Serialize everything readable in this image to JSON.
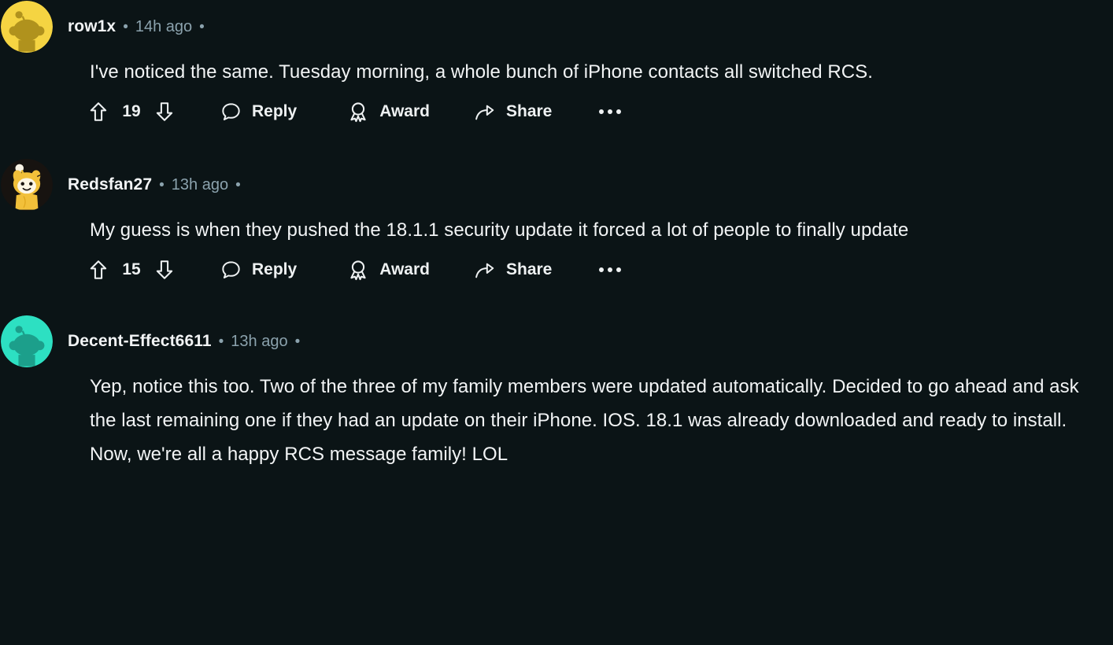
{
  "theme": {
    "background": "#0b1416",
    "text_primary": "#f2f4f5",
    "text_muted": "#8ba2ad"
  },
  "comments": [
    {
      "id": "comment-1",
      "username": "row1x",
      "timestamp": "14h ago",
      "separator": "•",
      "avatar": {
        "name": "avatar-snoo-yellow",
        "circle_color": "#f5d442",
        "snoo_color": "#b99a1f"
      },
      "body": "I've noticed the same. Tuesday morning, a whole bunch of iPhone contacts all switched RCS.",
      "actions": {
        "upvote_icon": "upvote-arrow-icon",
        "vote_count": "19",
        "downvote_icon": "downvote-arrow-icon",
        "reply_icon": "comment-bubble-icon",
        "reply_label": "Reply",
        "award_icon": "award-medal-icon",
        "award_label": "Award",
        "share_icon": "share-arrow-icon",
        "share_label": "Share",
        "more_icon": "more-options-icon"
      }
    },
    {
      "id": "comment-2",
      "username": "Redsfan27",
      "timestamp": "13h ago",
      "separator": "•",
      "avatar": {
        "name": "avatar-snoo-tiger-costume",
        "circle_color": "#1a1410",
        "snoo_color": "#f2c03a"
      },
      "body": "My guess is when they pushed the 18.1.1 security update it forced a lot of people to finally update",
      "actions": {
        "upvote_icon": "upvote-arrow-icon",
        "vote_count": "15",
        "downvote_icon": "downvote-arrow-icon",
        "reply_icon": "comment-bubble-icon",
        "reply_label": "Reply",
        "award_icon": "award-medal-icon",
        "award_label": "Award",
        "share_icon": "share-arrow-icon",
        "share_label": "Share",
        "more_icon": "more-options-icon"
      }
    },
    {
      "id": "comment-3",
      "username": "Decent-Effect6611",
      "timestamp": "13h ago",
      "separator": "•",
      "avatar": {
        "name": "avatar-snoo-teal",
        "circle_color": "#2de0c2",
        "snoo_color": "#1fa893"
      },
      "body": "Yep, notice this too. Two of the three of my family members were updated automatically. Decided to go ahead and ask the last remaining one if they had an update on their iPhone. IOS. 18.1 was already downloaded and ready to install. Now, we're all a happy RCS message family! LOL"
    }
  ]
}
